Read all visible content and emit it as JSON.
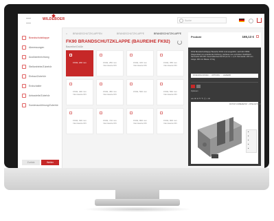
{
  "app": {
    "brand": "WILDEBOER"
  },
  "header": {
    "search_placeholder": "Suche"
  },
  "breadcrumb": [
    "BRANDSCHUTZKLAPPEN",
    "BRANDSCHUTZKLAPPE",
    "BRANDSCHUTZKLAPPE"
  ],
  "page": {
    "title": "FK90 BRANDSCHUTZKLAPPE (BAUREIHE FK92)",
    "subtitle": "Baureihe/Größe"
  },
  "sidebar": {
    "items": [
      {
        "label": "Brandschutzklappe",
        "active": true
      },
      {
        "label": "Abmessungen",
        "active": false
      },
      {
        "label": "Auslöseeinrichtung",
        "active": false
      },
      {
        "label": "Stellantriebe/Zubehör",
        "active": false
      },
      {
        "label": "Einbau/Zubehör",
        "active": false
      },
      {
        "label": "Endschalter",
        "active": false
      },
      {
        "label": "Anbauteile/Zubehör",
        "active": false
      },
      {
        "label": "Sonderausführung/Zubehör",
        "active": false
      }
    ],
    "back_label": "Zurück",
    "next_label": "Weiter"
  },
  "tiles": [
    {
      "label": "FK92, 200 mm",
      "selected": true
    },
    {
      "label": "FK92, 250 mm Nennweite DN",
      "selected": false
    },
    {
      "label": "FK92, 315 mm Nennweite DN",
      "selected": false
    },
    {
      "label": "FK92, 355 mm Nennweite DN",
      "selected": false
    },
    {
      "label": "FK92, 400 mm Nennweite DN",
      "selected": false
    },
    {
      "label": "FK92, 450 mm Nennweite DN",
      "selected": false
    },
    {
      "label": "FK92, 500 mm",
      "selected": false
    },
    {
      "label": "FK92, 560 mm Nennweite DN",
      "selected": false
    },
    {
      "label": "FK92, 630 mm Nennweite DN",
      "selected": false
    },
    {
      "label": "FK92, 710 mm Nennweite DN",
      "selected": false
    },
    {
      "label": "FK92, 800 mm Nennweite DN",
      "selected": false
    },
    {
      "label": "FK92, 900 mm Nennweite DN",
      "selected": false
    }
  ],
  "product_panel": {
    "name": "Produkt",
    "price": "165,13 €",
    "description": "FK92 Brandschutzklappe Baureihe FK92 rund ausgeführt, nach EN 15650. Klappenblatt mit umlaufender Dichtung, Gehäuse aus verzinktem Stahlblech. Nennweite DN 200. Feuerwiderstand EI 90 (ve ho i↔o) S. Nennweite: 200 mm Länge: 400 mm Masse: 4,5 kg",
    "selection_row": "FK92/200/LV/K90A/... - OPTIONS ... - LIEFERB",
    "option_label": "Optionen",
    "viewer_label": "MOTOR VORBEREITET - OHNE ANTRIEB"
  },
  "colors": {
    "accent": "#c62828",
    "panel_bg": "#3a3a3a"
  }
}
